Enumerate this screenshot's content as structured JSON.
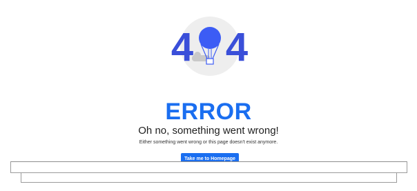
{
  "error_page": {
    "illustration": {
      "digit_left": "4",
      "digit_right": "4",
      "icon": "hot-air-balloon-icon"
    },
    "heading": "ERROR",
    "subheading": "Oh no, something went wrong!",
    "description": "Either something went wrong or this page doesn't exist anymore.",
    "home_button_label": "Take me to Homepage"
  },
  "colors": {
    "accent": "#1a6ef0",
    "digit_blue": "#3a4fd9",
    "balloon_blue": "#3c5cf5",
    "circle_bg": "#eeeeee",
    "cloud_gray": "#c9c9c9"
  }
}
